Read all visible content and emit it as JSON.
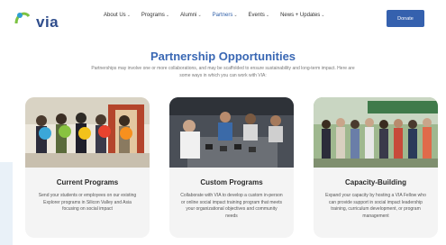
{
  "brand": {
    "logo_text": "via",
    "logo_icon": "via-logo-icon"
  },
  "nav": [
    {
      "label": "About Us",
      "active": false
    },
    {
      "label": "Programs",
      "active": false
    },
    {
      "label": "Alumni",
      "active": false
    },
    {
      "label": "Partners",
      "active": true
    },
    {
      "label": "Events",
      "active": false
    },
    {
      "label": "News + Updates",
      "active": false
    }
  ],
  "donate_label": "Donate",
  "page": {
    "title": "Partnership Opportunities",
    "intro": "Partnerships may involve one or more collaborations, and may be scaffolded to ensure sustainability and long-term impact. Here are some ways in which you can work with VIA:"
  },
  "cards": [
    {
      "title": "Current Programs",
      "description": "Send your students or employees on our existing Explorer programs in Silicon Valley and Asia focusing on social impact",
      "image_icon": "students-holding-signs-photo"
    },
    {
      "title": "Custom Programs",
      "description": "Collaborate with VIA to develop a custom in-person or online social impact training program that meets your organizational objectives and community needs",
      "image_icon": "workshop-group-photo"
    },
    {
      "title": "Capacity-Building",
      "description": "Expand your capacity by hosting a VIA Fellow who can provide support in social impact leadership training, curriculum development, or program management",
      "image_icon": "group-outdoor-photo"
    }
  ],
  "colors": {
    "accent": "#3a68b4",
    "donate": "#3561ae",
    "logo_green": "#7cc242"
  }
}
